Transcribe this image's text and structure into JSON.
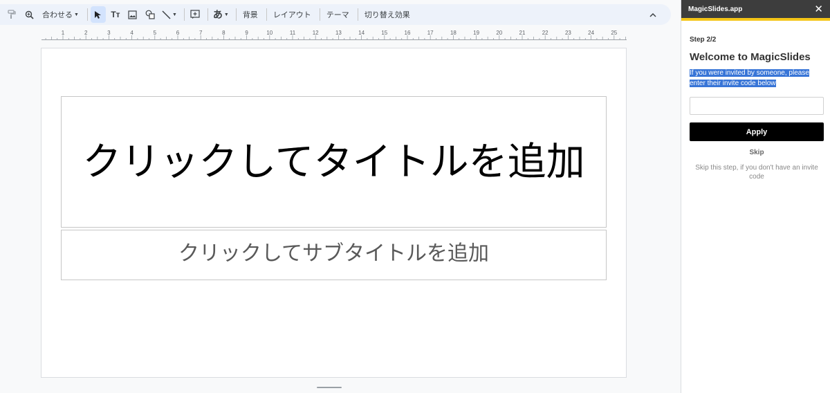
{
  "toolbar": {
    "zoom_label": "合わせる",
    "bg_label": "背景",
    "layout_label": "レイアウト",
    "theme_label": "テーマ",
    "transition_label": "切り替え効果",
    "text_tool_glyph": "Tт",
    "ime_glyph": "あ"
  },
  "ruler": {
    "labels": [
      "1",
      "2",
      "3",
      "4",
      "5",
      "6",
      "7",
      "8",
      "9",
      "10",
      "11",
      "12",
      "13",
      "14",
      "15",
      "16",
      "17",
      "18",
      "19",
      "20",
      "21",
      "22",
      "23",
      "24",
      "25"
    ]
  },
  "slide": {
    "title": "クリックしてタイトルを追加",
    "subtitle": "クリックしてサブタイトルを追加"
  },
  "panel": {
    "app_name": "MagicSlides.app",
    "step": "Step 2/2",
    "welcome": "Welcome to MagicSlides",
    "invite_text": "If you were invited by someone, please enter their invite code below",
    "invite_code_value": "",
    "apply_label": "Apply",
    "skip_label": "Skip",
    "skip_note": "Skip this step, if you don't have an invite code"
  },
  "colors": {
    "toolbar_bg": "#edf2fa",
    "selected_tool": "#d3e3fd",
    "panel_header": "#3d3d3d",
    "panel_accent": "#f5c518",
    "highlight": "#3875d7"
  }
}
